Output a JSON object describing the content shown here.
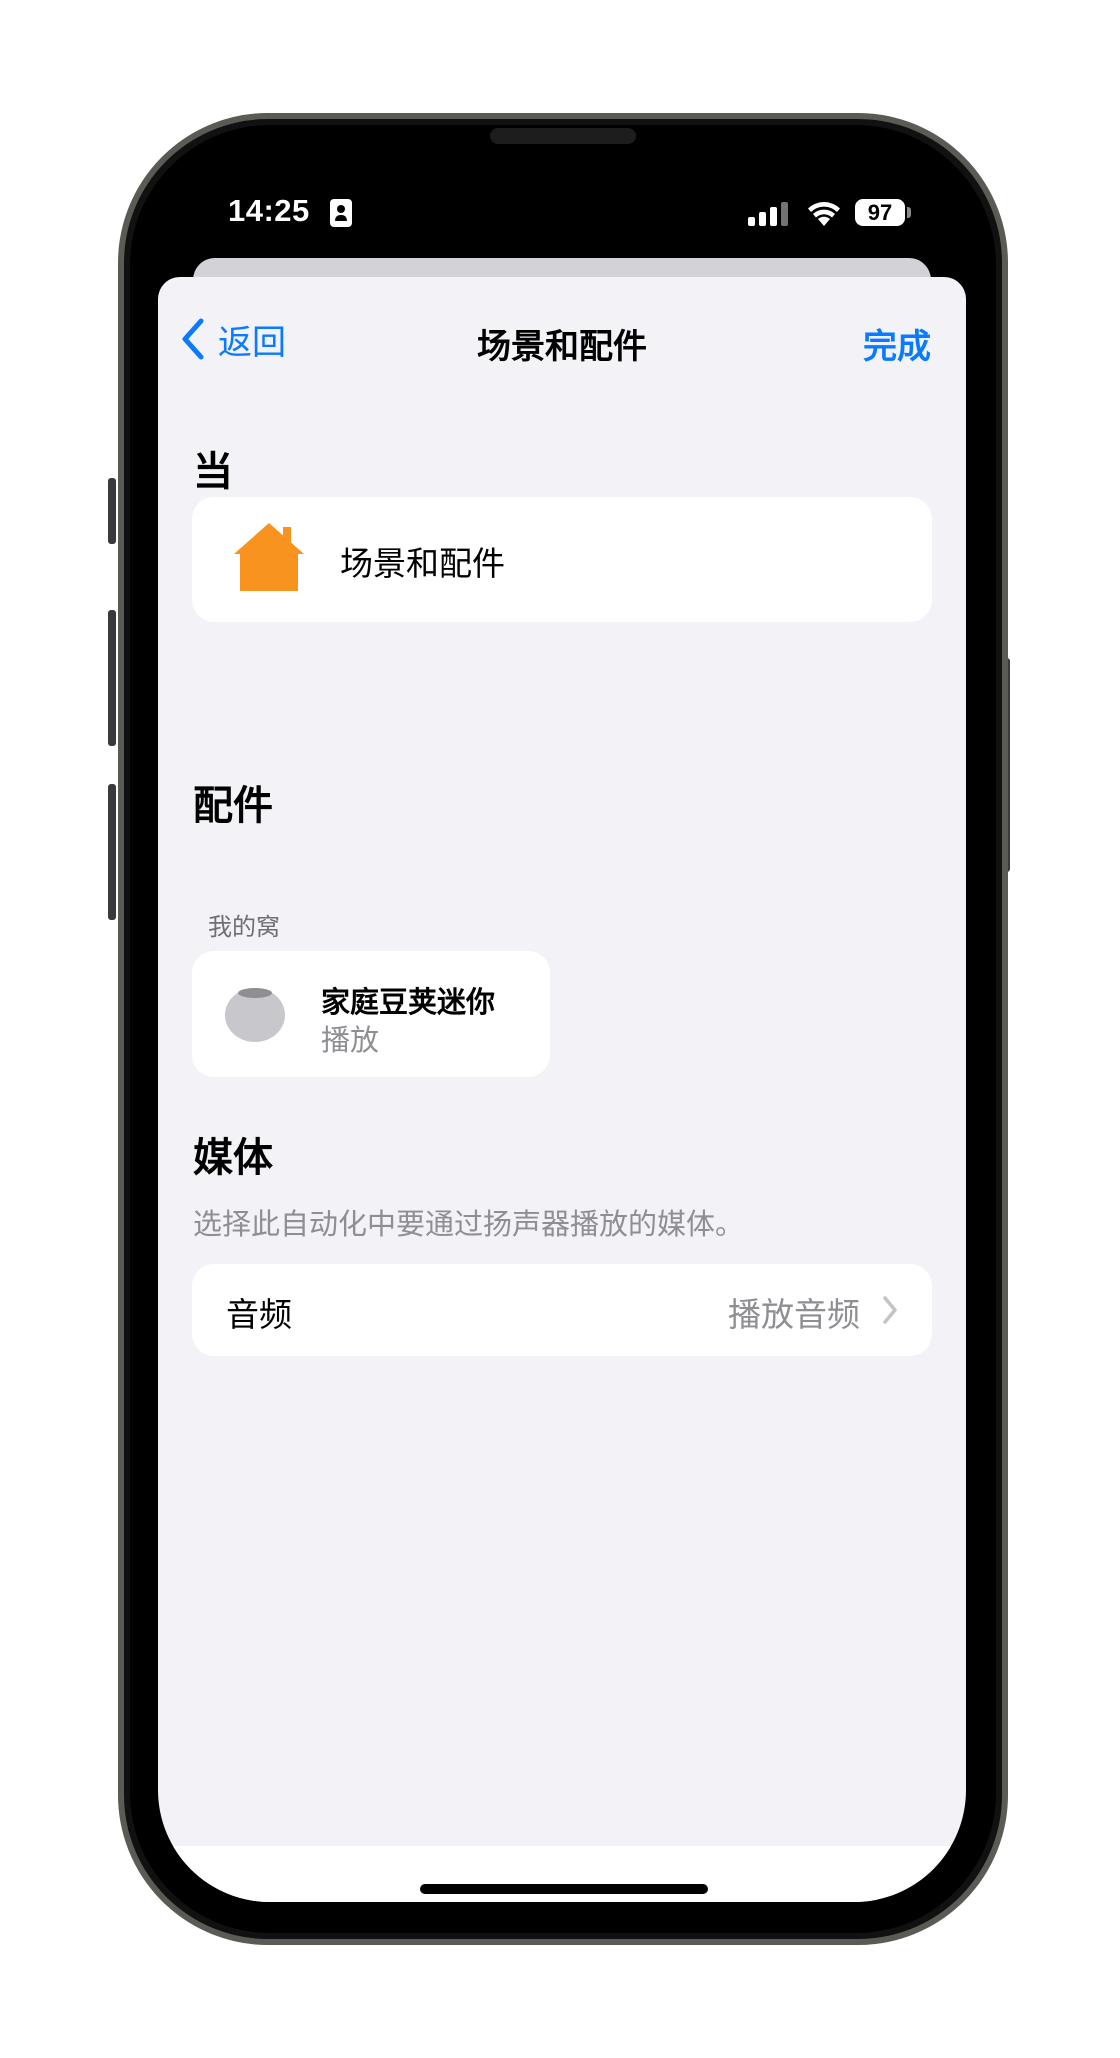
{
  "status_bar": {
    "time": "14:25",
    "battery": "97"
  },
  "nav": {
    "back_label": "返回",
    "title": "场景和配件",
    "done_label": "完成"
  },
  "when_section": {
    "header": "当",
    "item_label": "场景和配件",
    "icon": "house-icon",
    "icon_color": "#f7931e"
  },
  "accessories_section": {
    "header": "配件",
    "room": "我的窝",
    "accessory": {
      "name": "家庭豆荚迷你",
      "status": "播放",
      "icon": "homepod-mini-icon"
    }
  },
  "media_section": {
    "header": "媒体",
    "description": "选择此自动化中要通过扬声器播放的媒体。",
    "row_label": "音频",
    "row_value": "播放音频"
  },
  "colors": {
    "accent": "#0a7aff",
    "background": "#f2f2f7"
  }
}
